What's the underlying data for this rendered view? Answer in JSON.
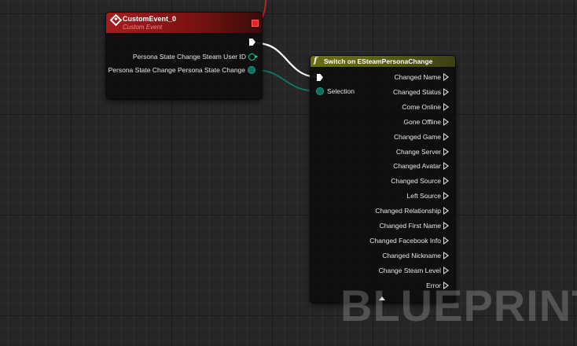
{
  "custom_event": {
    "title": "CustomEvent_0",
    "subtitle": "Custom Event",
    "outputs": [
      "Persona State Change Steam User ID",
      "Persona State Change Persona State Change"
    ]
  },
  "switch_node": {
    "title": "Switch on ESteamPersonaChange",
    "selection_label": "Selection",
    "cases": [
      "Changed Name",
      "Changed Status",
      "Come Online",
      "Gone Offline",
      "Changed Game",
      "Change Server",
      "Changed Avatar",
      "Changed Source",
      "Left Source",
      "Changed Relationship",
      "Changed First Name",
      "Changed Facebook Info",
      "Changed Nickname",
      "Change Steam Level",
      "Error"
    ]
  },
  "watermark": "BLUEPRINT",
  "colors": {
    "event_header": "#a51c1c",
    "function_header": "#6a6f10",
    "exec_wire": "#ffffff",
    "struct_pin": "#1fd0a0",
    "byte_wire": "#0e6e5e",
    "delegate_pin": "#e82020"
  }
}
